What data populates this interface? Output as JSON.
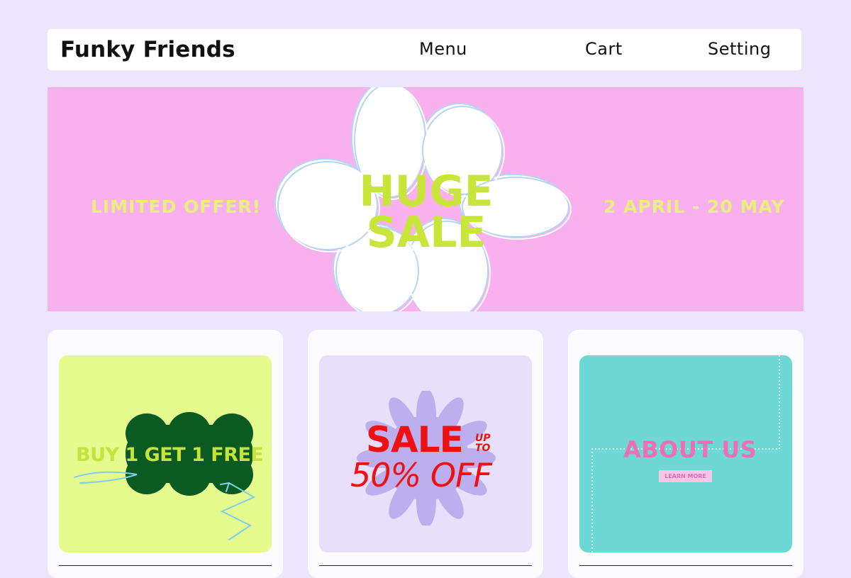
{
  "header": {
    "brand": "Funky Friends",
    "nav": {
      "menu": "Menu",
      "cart": "Cart",
      "setting": "Setting"
    }
  },
  "banner": {
    "left_text": "LIMITED OFFER!",
    "headline_line1": "HUGE",
    "headline_line2": "SALE",
    "right_text": "2 APRIL - 20 MAY"
  },
  "cards": [
    {
      "text": "BUY 1 GET 1 FREE"
    },
    {
      "sale": "SALE",
      "up": "UP",
      "to": "TO",
      "off": "50% OFF"
    },
    {
      "title": "ABOUT US",
      "button": "LEARN MORE"
    }
  ],
  "colors": {
    "page_bg": "#ebe6fc",
    "banner_bg": "#f9b0ef",
    "banner_text": "#e9f07a",
    "huge_sale": "#c8e63a",
    "card1_bg": "#e5fb8e",
    "card1_blob": "#0b5a22",
    "card2_bg": "#e6e0fb",
    "sale_red": "#ee1111",
    "card3_bg": "#6ed8d4",
    "about_pink": "#ee6fb5"
  },
  "icons": [
    "flower-sky-shape",
    "scribble-arrow",
    "starburst-shape"
  ]
}
